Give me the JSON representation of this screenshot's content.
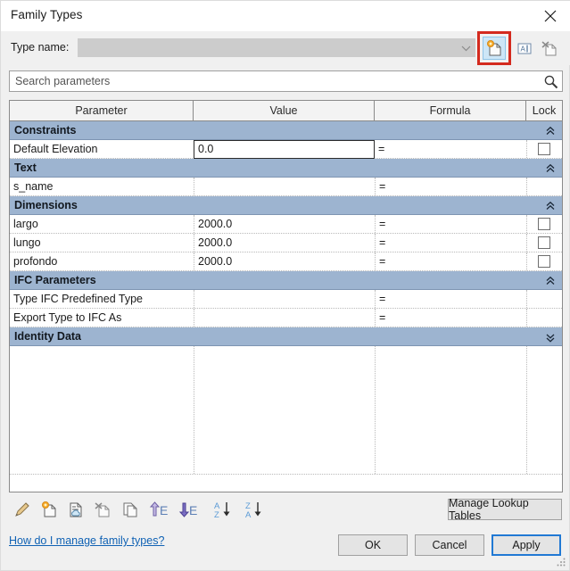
{
  "window": {
    "title": "Family Types",
    "close_icon": "close-icon"
  },
  "typename": {
    "label": "Type name:",
    "value": "",
    "placeholder": "",
    "dropdown_icon": "chevron-down-icon",
    "buttons": [
      {
        "name": "new-type-button",
        "icon": "new-page-icon",
        "tooltip": "New Type",
        "highlighted": true
      },
      {
        "name": "rename-type-button",
        "icon": "rename-abc-icon",
        "tooltip": "Rename",
        "highlighted": false
      },
      {
        "name": "delete-type-button",
        "icon": "delete-page-icon",
        "tooltip": "Delete Type",
        "highlighted": false
      }
    ]
  },
  "search": {
    "placeholder": "Search parameters",
    "value": "",
    "icon": "search-icon"
  },
  "table": {
    "columns": [
      "Parameter",
      "Value",
      "Formula",
      "Lock"
    ],
    "groups": [
      {
        "label": "Constraints",
        "collapsed": false,
        "chevron": "double-chevron-up-icon",
        "rows": [
          {
            "parameter": "Default Elevation",
            "value": "0.0",
            "formula": "=",
            "lock": true,
            "active": true
          }
        ]
      },
      {
        "label": "Text",
        "collapsed": false,
        "chevron": "double-chevron-up-icon",
        "rows": [
          {
            "parameter": "s_name",
            "value": "",
            "formula": "=",
            "lock": false,
            "active": false
          }
        ]
      },
      {
        "label": "Dimensions",
        "collapsed": false,
        "chevron": "double-chevron-up-icon",
        "rows": [
          {
            "parameter": "largo",
            "value": "2000.0",
            "formula": "=",
            "lock": true,
            "active": false
          },
          {
            "parameter": "lungo",
            "value": "2000.0",
            "formula": "=",
            "lock": true,
            "active": false
          },
          {
            "parameter": "profondo",
            "value": "2000.0",
            "formula": "=",
            "lock": true,
            "active": false
          }
        ]
      },
      {
        "label": "IFC Parameters",
        "collapsed": false,
        "chevron": "double-chevron-up-icon",
        "rows": [
          {
            "parameter": "Type IFC Predefined Type",
            "value": "",
            "formula": "=",
            "lock": false,
            "active": false
          },
          {
            "parameter": "Export Type to IFC As",
            "value": "",
            "formula": "=",
            "lock": false,
            "active": false
          }
        ]
      },
      {
        "label": "Identity Data",
        "collapsed": true,
        "chevron": "double-chevron-down-icon",
        "rows": []
      }
    ]
  },
  "toolbar": {
    "items": [
      {
        "name": "edit-parameter-button",
        "icon": "pencil-icon"
      },
      {
        "name": "new-parameter-button",
        "icon": "new-page-icon"
      },
      {
        "name": "lookup-table-button",
        "icon": "page-cloud-icon"
      },
      {
        "name": "remove-parameter-button",
        "icon": "delete-page-icon"
      },
      {
        "name": "duplicate-button",
        "icon": "copy-pages-icon"
      },
      {
        "name": "move-up-button",
        "icon": "arrow-up-e-icon"
      },
      {
        "name": "move-down-button",
        "icon": "arrow-down-e-icon"
      },
      {
        "name": "sort-ascending-button",
        "icon": "sort-az-icon"
      },
      {
        "name": "sort-descending-button",
        "icon": "sort-za-icon"
      }
    ]
  },
  "footer": {
    "help_link": "How do I manage family types?",
    "manage_lookup_tables": "Manage Lookup Tables",
    "ok": "OK",
    "cancel": "Cancel",
    "apply": "Apply"
  },
  "colors": {
    "group_header": "#9db4d0",
    "highlight_rect": "#d42a1e",
    "focus_border": "#2179d4",
    "link": "#1062b4",
    "dialog_bg": "#f0f0f0"
  }
}
